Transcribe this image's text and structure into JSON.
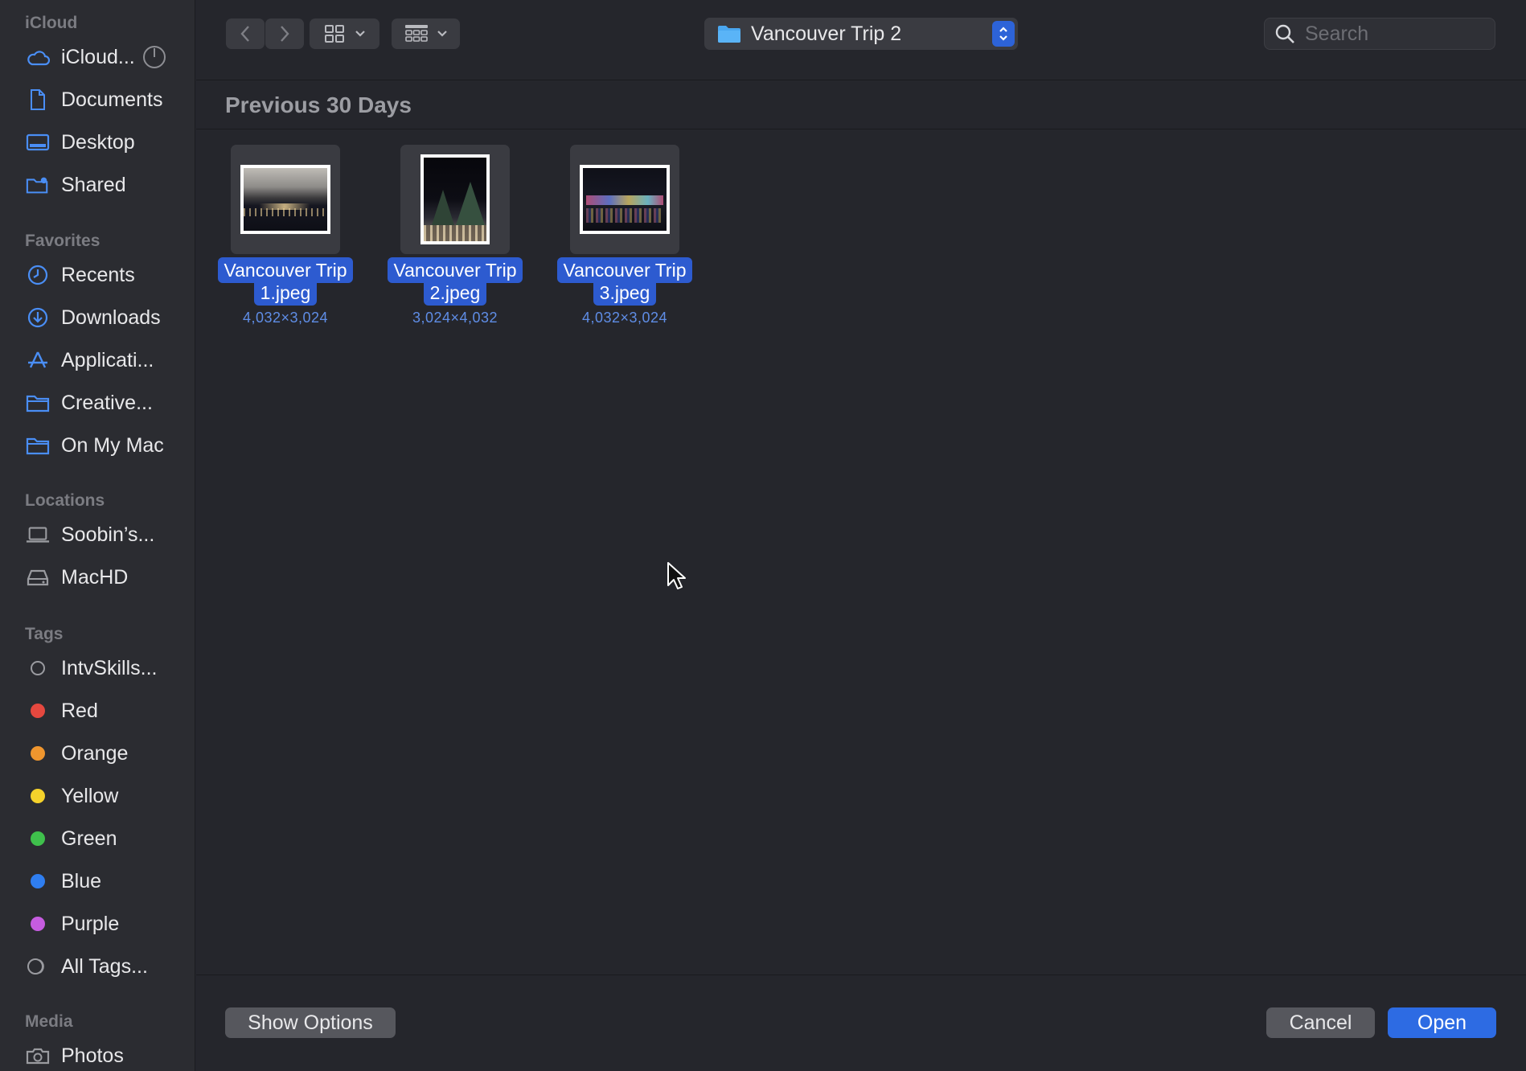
{
  "sidebar": {
    "icloud_title": "iCloud",
    "icloud_items": [
      {
        "label": "iCloud...",
        "icon": "cloud-icon"
      },
      {
        "label": "Documents",
        "icon": "document-icon"
      },
      {
        "label": "Desktop",
        "icon": "desktop-icon"
      },
      {
        "label": "Shared",
        "icon": "shared-folder-icon"
      }
    ],
    "favorites_title": "Favorites",
    "favorites": [
      {
        "label": "Recents",
        "icon": "clock-icon"
      },
      {
        "label": "Downloads",
        "icon": "download-icon"
      },
      {
        "label": "Applicati...",
        "icon": "applications-icon"
      },
      {
        "label": "Creative...",
        "icon": "folder-icon"
      },
      {
        "label": "On My Mac",
        "icon": "folder-icon"
      }
    ],
    "locations_title": "Locations",
    "locations": [
      {
        "label": "Soobin’s...",
        "icon": "laptop-icon"
      },
      {
        "label": "MacHD",
        "icon": "drive-icon"
      }
    ],
    "tags_title": "Tags",
    "tags": [
      {
        "label": "IntvSkills...",
        "color": "none"
      },
      {
        "label": "Red",
        "color": "#e5483f"
      },
      {
        "label": "Orange",
        "color": "#f0962e"
      },
      {
        "label": "Yellow",
        "color": "#f5d22b"
      },
      {
        "label": "Green",
        "color": "#3fc04c"
      },
      {
        "label": "Blue",
        "color": "#2f7ef0"
      },
      {
        "label": "Purple",
        "color": "#c65ce0"
      },
      {
        "label": "All Tags...",
        "color": "all"
      }
    ],
    "media_title": "Media",
    "media": [
      {
        "label": "Photos",
        "icon": "camera-icon"
      }
    ]
  },
  "toolbar": {
    "current_folder": "Vancouver Trip 2",
    "search_placeholder": "Search"
  },
  "content": {
    "group_header": "Previous 30 Days",
    "files": [
      {
        "name_line1": "Vancouver Trip",
        "name_line2": "1.jpeg",
        "dims": "4,032×3,024"
      },
      {
        "name_line1": "Vancouver Trip",
        "name_line2": "2.jpeg",
        "dims": "3,024×4,032"
      },
      {
        "name_line1": "Vancouver Trip",
        "name_line2": "3.jpeg",
        "dims": "4,032×3,024"
      }
    ]
  },
  "bottom": {
    "show_options": "Show Options",
    "cancel": "Cancel",
    "open": "Open"
  },
  "colors": {
    "accent": "#2d6be3",
    "selection": "#2d5bd0"
  }
}
